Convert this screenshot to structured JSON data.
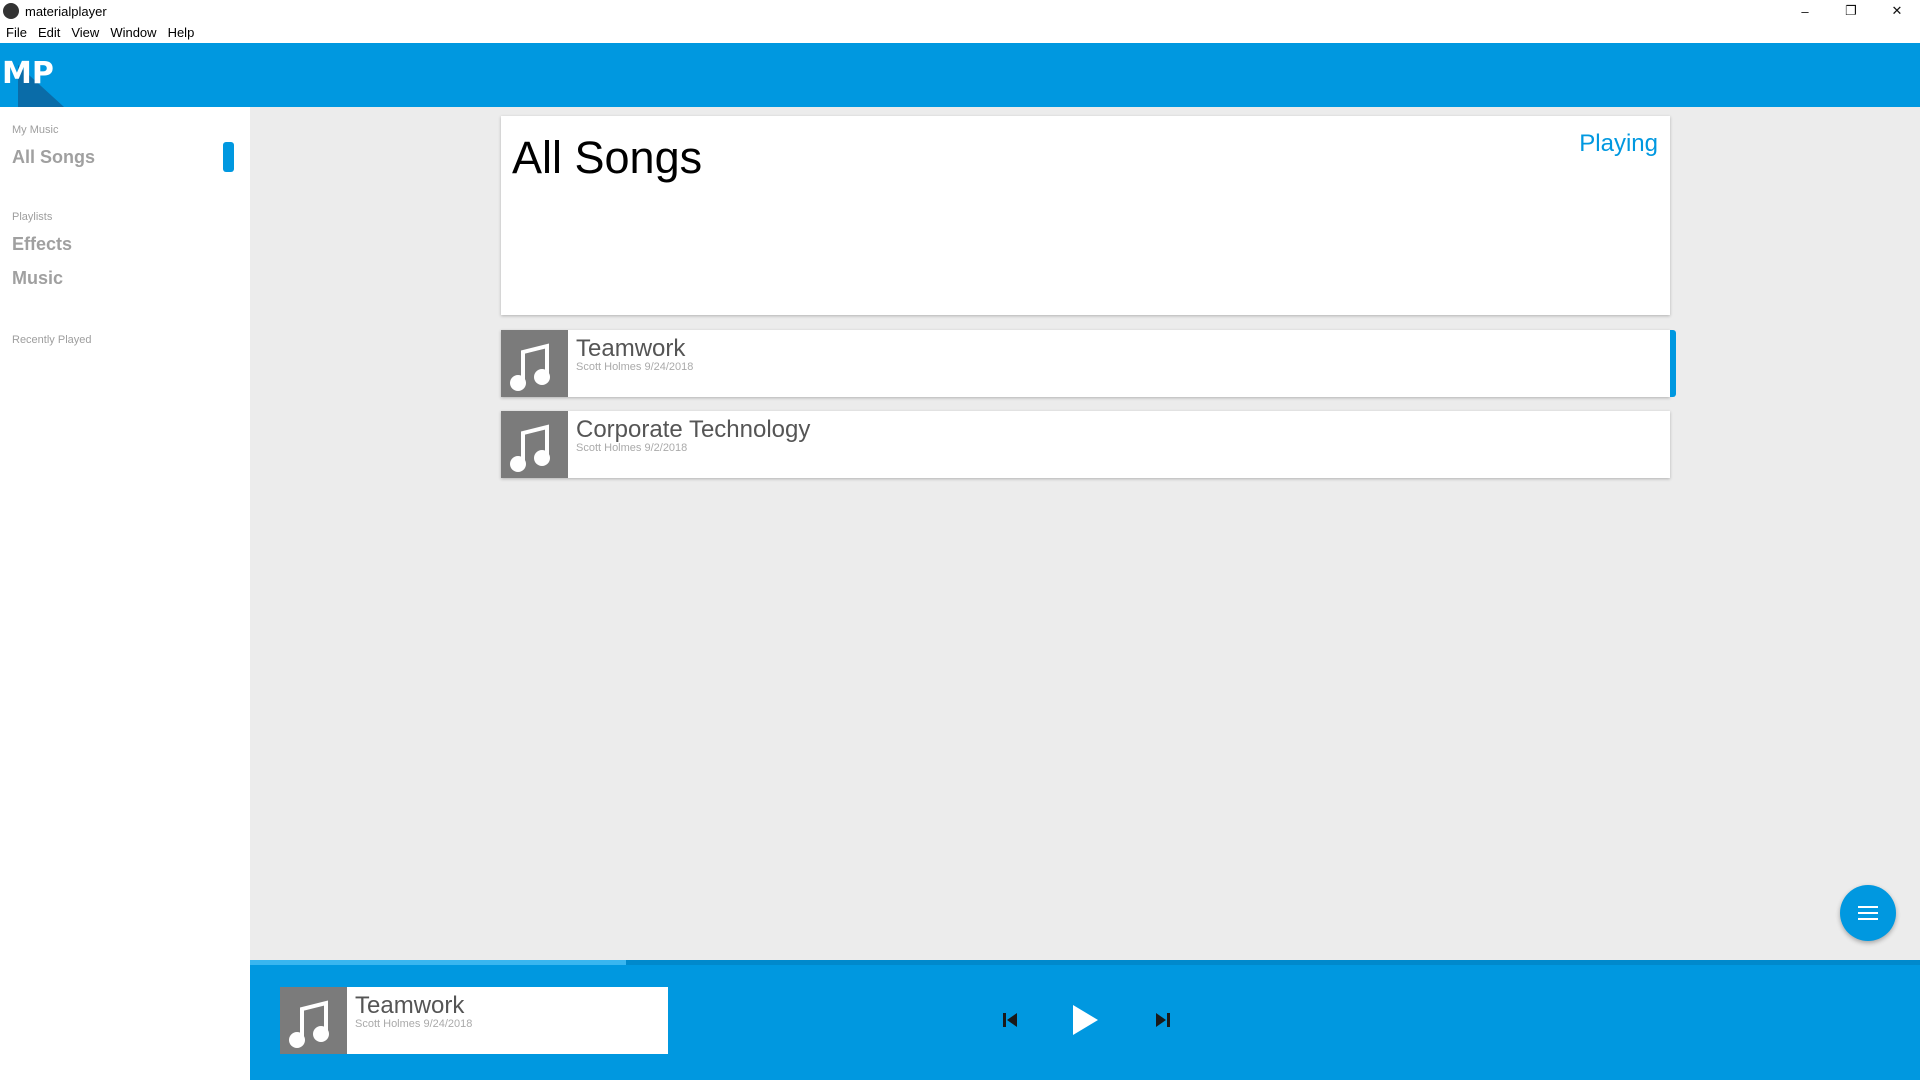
{
  "window": {
    "title": "materialplayer",
    "controls": [
      "–",
      "❐",
      "✕"
    ]
  },
  "menu": [
    "File",
    "Edit",
    "View",
    "Window",
    "Help"
  ],
  "logo": {
    "text": "MP"
  },
  "sidebar": {
    "my_music_label": "My Music",
    "all_songs": "All Songs",
    "playlists_label": "Playlists",
    "playlists": [
      "Effects",
      "Music"
    ],
    "recently_played_label": "Recently Played"
  },
  "main": {
    "title": "All Songs",
    "playing_link": "Playing",
    "songs": [
      {
        "title": "Teamwork",
        "artist_date": "Scott Holmes 9/24/2018",
        "active": true
      },
      {
        "title": "Corporate Technology",
        "artist_date": "Scott Holmes 9/2/2018",
        "active": false
      }
    ]
  },
  "player": {
    "title": "Teamwork",
    "artist_date": "Scott Holmes 9/24/2018",
    "progress": 0.225
  },
  "colors": {
    "accent": "#0098e0",
    "thumb": "#7b7b7b"
  },
  "icons": {
    "note": "music-note-icon",
    "prev": "skip-previous-icon",
    "play": "play-icon",
    "next": "skip-next-icon",
    "fab": "menu-icon"
  }
}
